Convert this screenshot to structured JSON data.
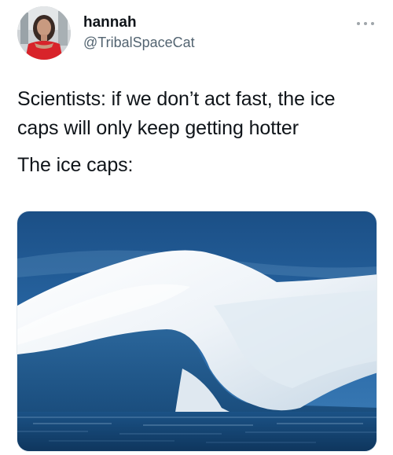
{
  "tweet": {
    "author": {
      "display_name": "hannah",
      "handle": "@TribalSpaceCat",
      "avatar_icon": "profile-photo"
    },
    "more_icon": "more-options-icon",
    "text_lines": [
      "Scientists: if we don’t act fast, the ice caps will only keep getting hotter",
      "The ice caps:"
    ],
    "media": {
      "kind": "photo",
      "colors": {
        "sky": "#1f5a94",
        "ice": "#eef3f7",
        "water": "#123f6b"
      }
    }
  }
}
